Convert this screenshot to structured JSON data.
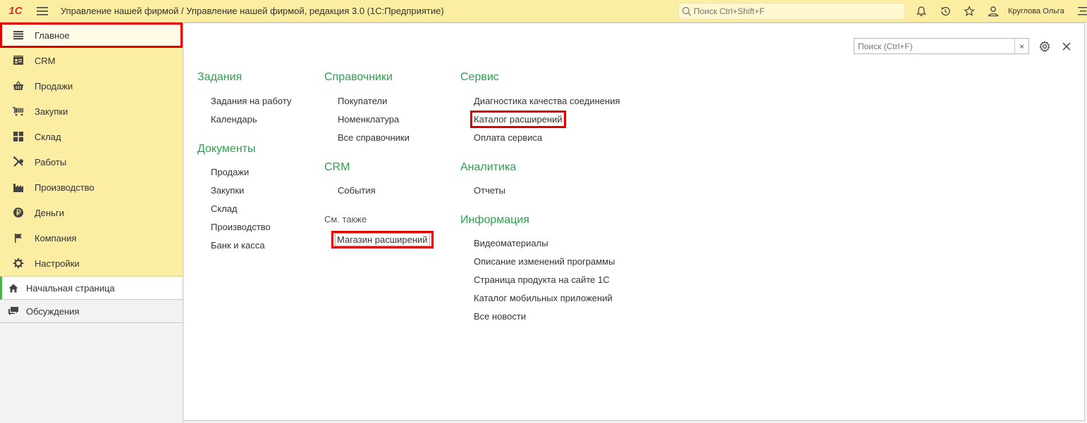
{
  "topbar": {
    "logo": "1С",
    "title": "Управление нашей фирмой / Управление нашей фирмой, редакция 3.0  (1С:Предприятие)",
    "search_placeholder": "Поиск Ctrl+Shift+F",
    "user": "Круглова Ольга",
    "icons": [
      "bell-icon",
      "history-icon",
      "star-icon",
      "user-icon",
      "settings-menu-icon"
    ]
  },
  "sidebar": {
    "sections": [
      {
        "label": "Главное",
        "icon": "menu-lines-icon",
        "active": true
      },
      {
        "label": "CRM",
        "icon": "contact-card-icon"
      },
      {
        "label": "Продажи",
        "icon": "basket-icon"
      },
      {
        "label": "Закупки",
        "icon": "cart-icon"
      },
      {
        "label": "Склад",
        "icon": "warehouse-icon"
      },
      {
        "label": "Работы",
        "icon": "tools-icon"
      },
      {
        "label": "Производство",
        "icon": "factory-icon"
      },
      {
        "label": "Деньги",
        "icon": "ruble-icon"
      },
      {
        "label": "Компания",
        "icon": "flag-icon"
      },
      {
        "label": "Настройки",
        "icon": "gear-icon"
      }
    ],
    "nav": [
      {
        "label": "Начальная страница",
        "icon": "home-icon"
      },
      {
        "label": "Обсуждения",
        "icon": "chat-icon"
      }
    ]
  },
  "main": {
    "search_placeholder": "Поиск (Ctrl+F)",
    "clear_label": "×",
    "col1": {
      "g1_title": "Задания",
      "g1_links": [
        "Задания на работу",
        "Календарь"
      ],
      "g2_title": "Документы",
      "g2_links": [
        "Продажи",
        "Закупки",
        "Склад",
        "Производство",
        "Банк и касса"
      ]
    },
    "col2": {
      "g1_title": "Справочники",
      "g1_links": [
        "Покупатели",
        "Номенклатура",
        "Все справочники"
      ],
      "g2_title": "CRM",
      "g2_links": [
        "События"
      ],
      "see_also": "См. также",
      "see_also_links": [
        "Магазин расширений"
      ]
    },
    "col3": {
      "g1_title": "Сервис",
      "g1_links": [
        "Диагностика качества соединения",
        "Каталог расширений",
        "Оплата сервиса"
      ],
      "g2_title": "Аналитика",
      "g2_links": [
        "Отчеты"
      ],
      "g3_title": "Информация",
      "g3_links": [
        "Видеоматериалы",
        "Описание изменений программы",
        "Страница продукта на сайте 1С",
        "Каталог мобильных приложений",
        "Все новости"
      ]
    }
  },
  "colors": {
    "topbar_bg": "#fbeda2",
    "section_title": "#2e9e4f",
    "highlight": "#e10000"
  }
}
